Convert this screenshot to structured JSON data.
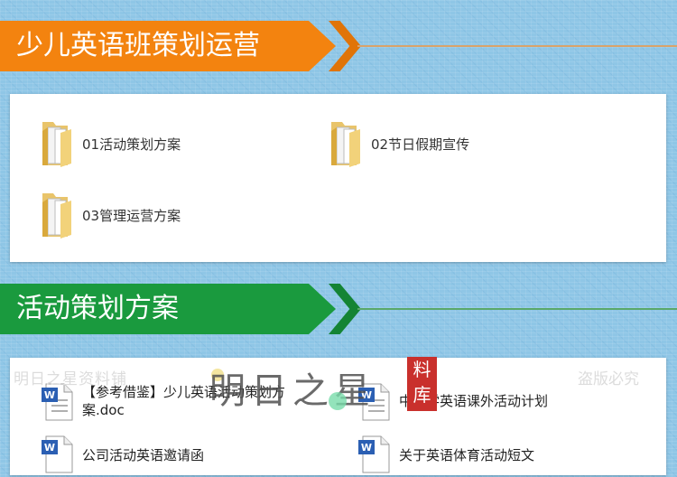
{
  "section1": {
    "title": "少儿英语班策划运营"
  },
  "folders": [
    {
      "label": "01活动策划方案"
    },
    {
      "label": "02节日假期宣传"
    },
    {
      "label": "03管理运营方案"
    }
  ],
  "section2": {
    "title": "活动策划方案"
  },
  "documents": [
    {
      "label": "【参考借鉴】少儿英语活动策划方案.doc"
    },
    {
      "label": "中小学英语课外活动计划"
    },
    {
      "label": "公司活动英语邀请函"
    },
    {
      "label": "关于英语体育活动短文"
    }
  ],
  "watermark": {
    "left_text": "明日之星资料铺",
    "right_text": "盗版必究",
    "logo_text": "明日之星",
    "seal_text": "料 库"
  },
  "colors": {
    "orange": "#f3830f",
    "green": "#1a9a3e",
    "word_blue": "#2b5fb3"
  }
}
